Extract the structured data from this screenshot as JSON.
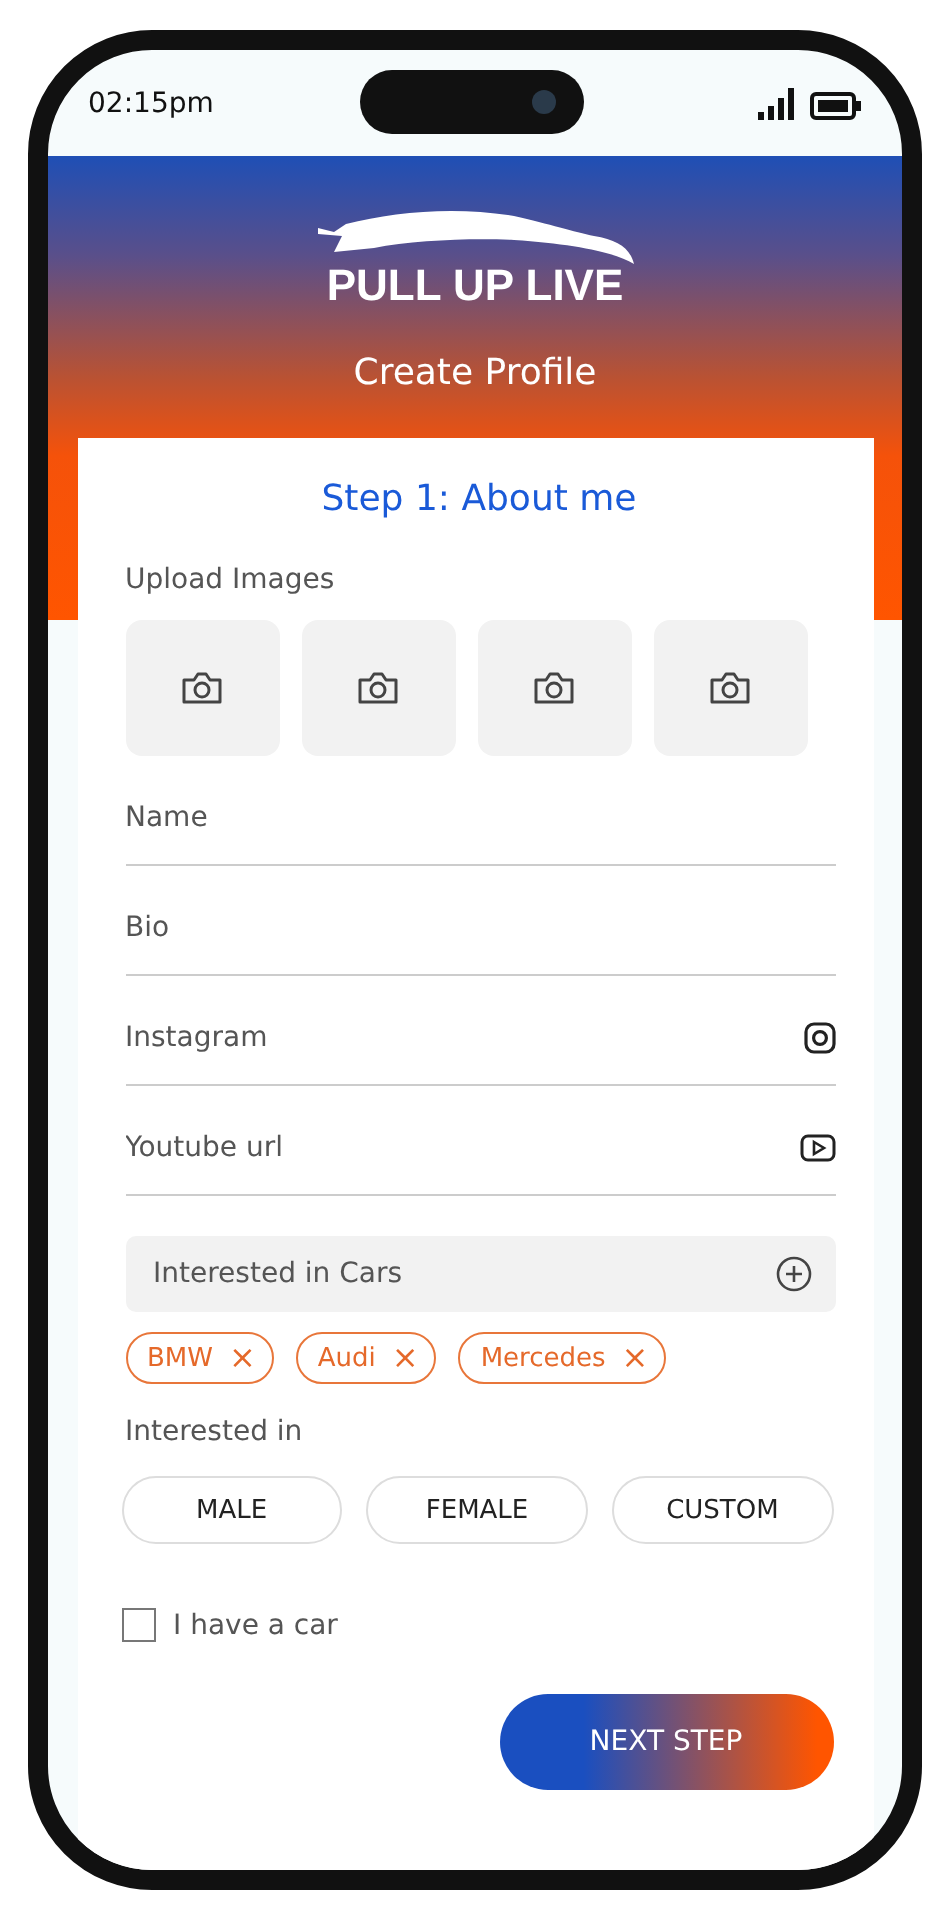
{
  "status_bar": {
    "time": "02:15pm"
  },
  "header": {
    "brand": "PULL UP LIVE",
    "title": "Create Profile"
  },
  "card": {
    "step_title": "Step 1: About me",
    "upload_label": "Upload Images",
    "image_slots": [
      {
        "kind": "empty"
      },
      {
        "kind": "empty"
      },
      {
        "kind": "empty"
      },
      {
        "kind": "empty"
      }
    ],
    "fields": [
      {
        "placeholder": "Name",
        "kind": "plain"
      },
      {
        "placeholder": "Bio",
        "kind": "plain"
      },
      {
        "placeholder": "Instagram",
        "kind": "instagram"
      },
      {
        "placeholder": "Youtube url",
        "kind": "youtube"
      }
    ],
    "cars_field": {
      "placeholder": "Interested in Cars"
    },
    "car_tags": [
      {
        "label": "BMW",
        "remove": "×"
      },
      {
        "label": "Audi",
        "remove": "×"
      },
      {
        "label": "Mercedes",
        "remove": "×"
      }
    ],
    "interested_label": "Interested in",
    "genders": [
      {
        "label": "MALE",
        "selected": false
      },
      {
        "label": "FEMALE",
        "selected": false
      },
      {
        "label": "CUSTOM",
        "selected": false
      }
    ],
    "have_car": {
      "label": "I have a car",
      "checked": false
    },
    "next_button": "NEXT STEP"
  }
}
